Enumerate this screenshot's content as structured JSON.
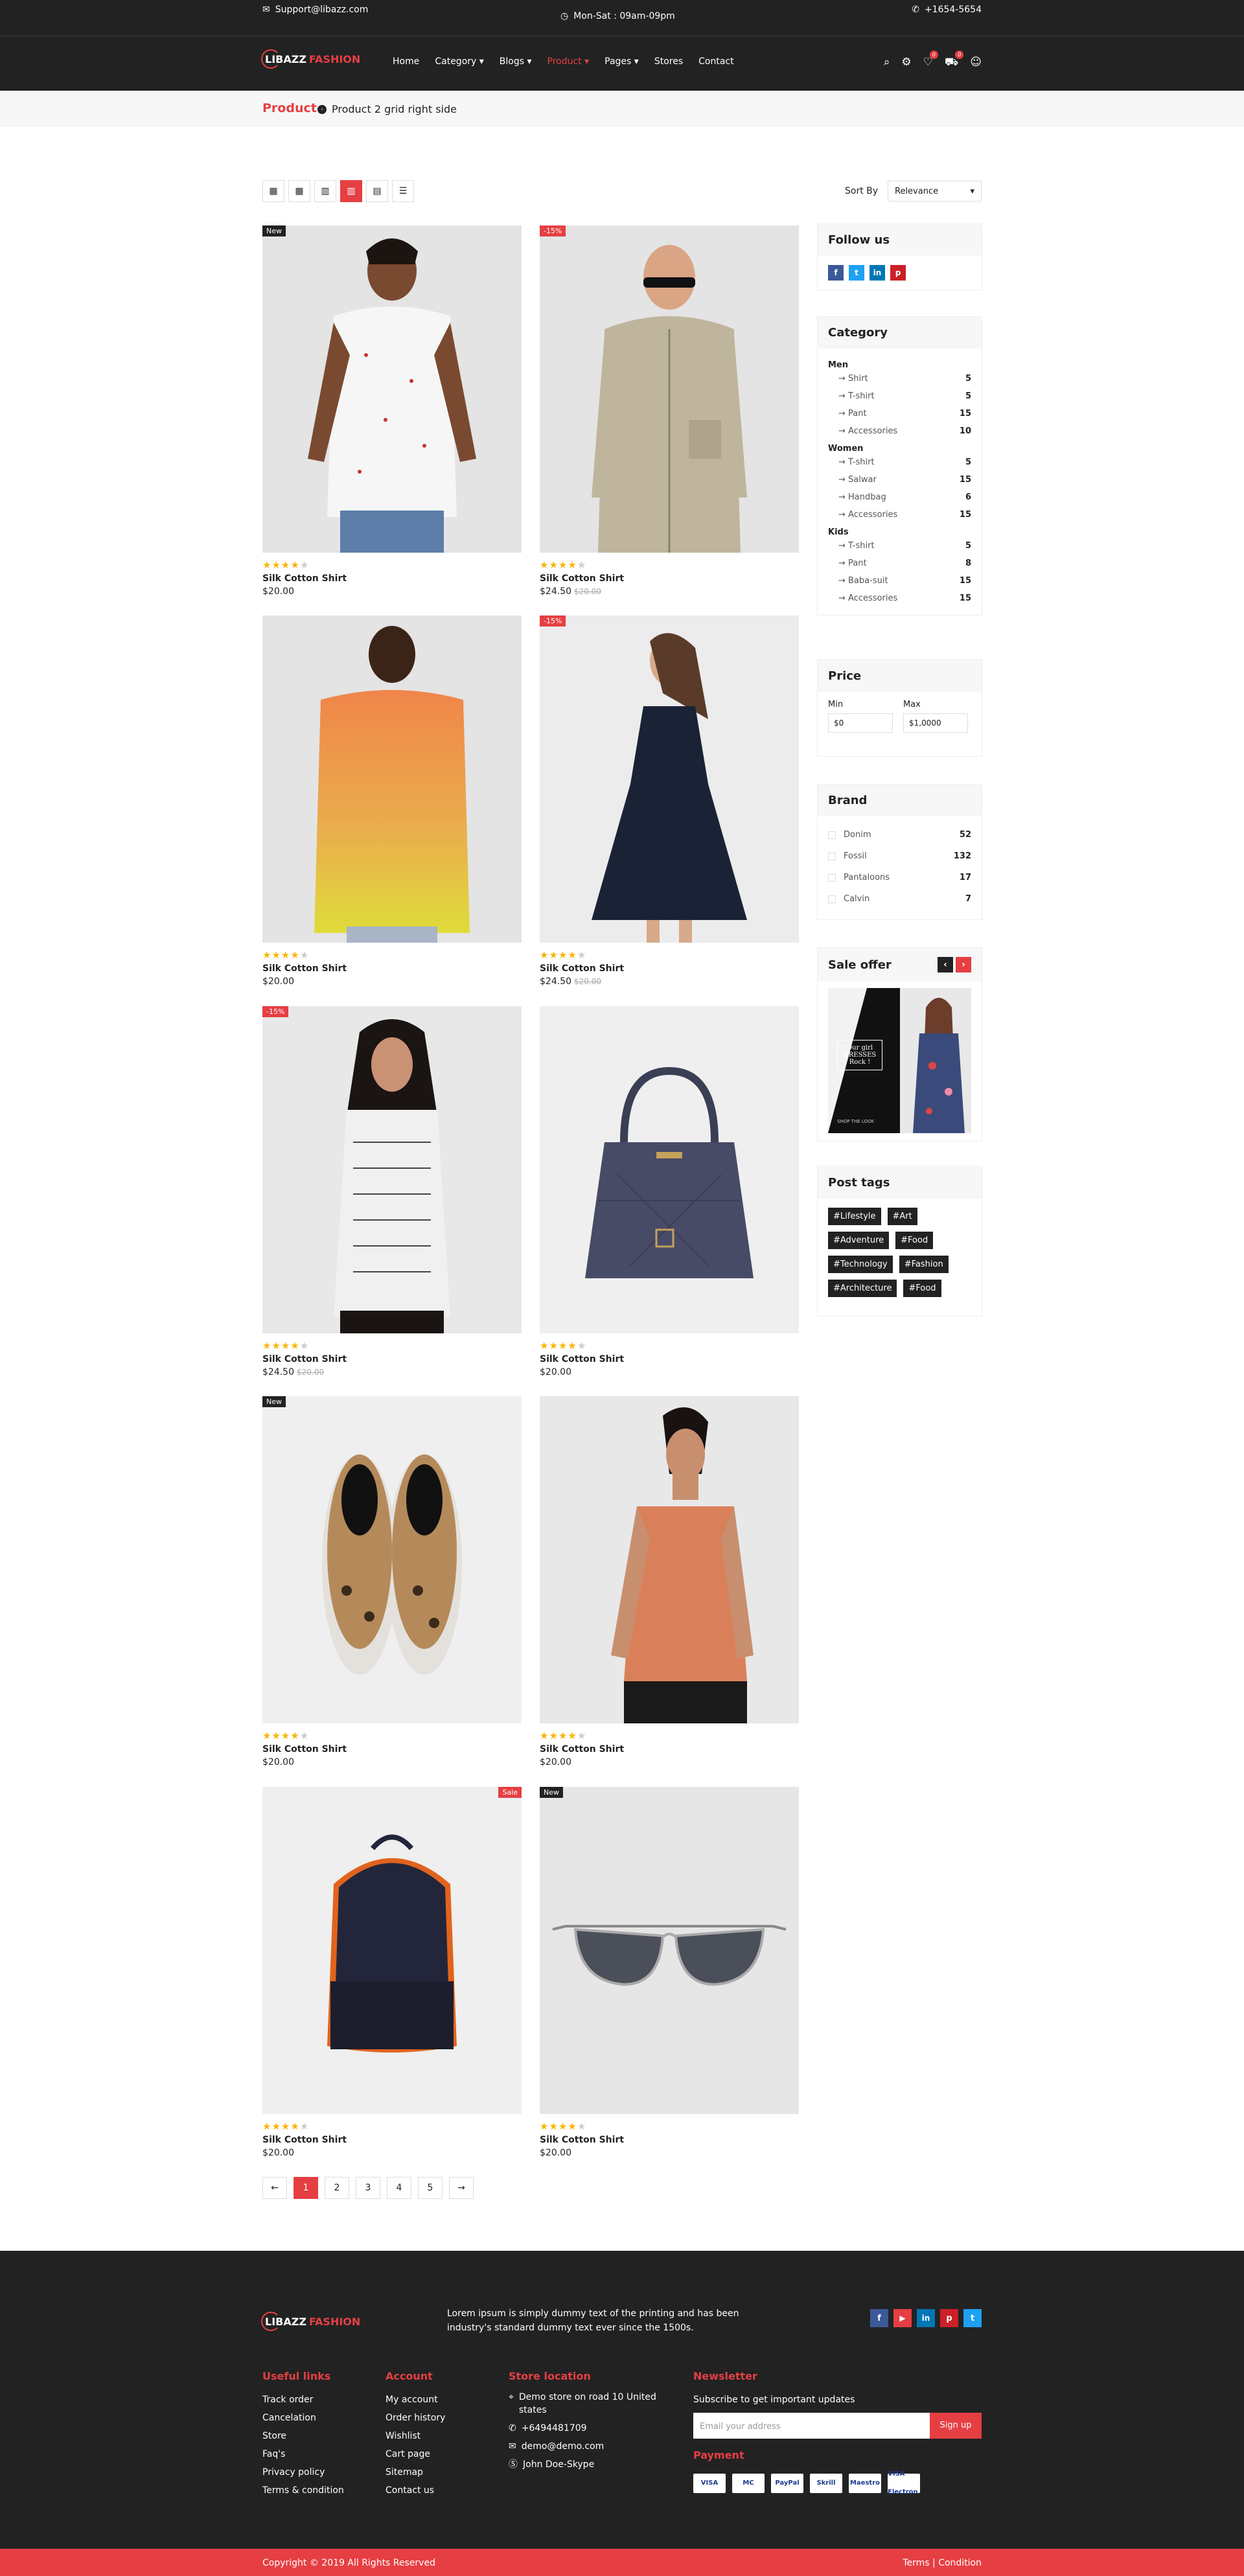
{
  "top": {
    "email": "Support@libazz.com",
    "hours": "Mon-Sat : 09am-09pm",
    "phone": "+1654-5654"
  },
  "brand": {
    "word1": "LIBAZZ",
    "word2": "FASHION"
  },
  "nav": [
    "Home",
    "Category",
    "Blogs",
    "Product",
    "Pages",
    "Stores",
    "Contact"
  ],
  "badges": {
    "wish": "0",
    "cart": "0"
  },
  "crumb": {
    "title": "Product",
    "sub": "Product 2 grid right side"
  },
  "sort": {
    "label": "Sort By",
    "value": "Relevance"
  },
  "products": [
    {
      "name": "Silk Cotton Shirt",
      "price": "$20.00",
      "old": "",
      "tag": "New",
      "tagType": "dark",
      "img": "shirt-man-white",
      "stars": 4
    },
    {
      "name": "Silk Cotton Shirt",
      "price": "$24.50",
      "old": "$20.00",
      "tag": "-15%",
      "tagType": "red",
      "img": "jacket-man",
      "stars": 4
    },
    {
      "name": "Silk Cotton Shirt",
      "price": "$20.00",
      "old": "",
      "tag": "",
      "tagType": "",
      "img": "shirt-orange",
      "stars": 4
    },
    {
      "name": "Silk Cotton Shirt",
      "price": "$24.50",
      "old": "$20.00",
      "tag": "-15%",
      "tagType": "red",
      "img": "dress-black",
      "stars": 4
    },
    {
      "name": "Silk Cotton Shirt",
      "price": "$24.50",
      "old": "$20.00",
      "tag": "-15%",
      "tagType": "red",
      "img": "top-print",
      "stars": 4
    },
    {
      "name": "Silk Cotton Shirt",
      "price": "$20.00",
      "old": "",
      "tag": "",
      "tagType": "",
      "img": "handbag",
      "stars": 4
    },
    {
      "name": "Silk Cotton Shirt",
      "price": "$20.00",
      "old": "",
      "tag": "New",
      "tagType": "dark",
      "img": "shoes",
      "stars": 4
    },
    {
      "name": "Silk Cotton Shirt",
      "price": "$20.00",
      "old": "",
      "tag": "",
      "tagType": "",
      "img": "camisole",
      "stars": 4
    },
    {
      "name": "Silk Cotton Shirt",
      "price": "$20.00",
      "old": "",
      "tag": "Sale",
      "tagType": "red",
      "img": "backpack",
      "stars": 4
    },
    {
      "name": "Silk Cotton Shirt",
      "price": "$20.00",
      "old": "",
      "tag": "New",
      "tagType": "dark",
      "img": "sunglasses",
      "stars": 4
    }
  ],
  "follow": {
    "title": "Follow us",
    "icons": [
      "f",
      "t",
      "in",
      "p"
    ]
  },
  "category": {
    "title": "Category",
    "groups": [
      {
        "name": "Men",
        "items": [
          [
            "Shirt",
            "5"
          ],
          [
            "T-shirt",
            "5"
          ],
          [
            "Pant",
            "15"
          ],
          [
            "Accessories",
            "10"
          ]
        ]
      },
      {
        "name": "Women",
        "items": [
          [
            "T-shirt",
            "5"
          ],
          [
            "Salwar",
            "15"
          ],
          [
            "Handbag",
            "6"
          ],
          [
            "Accessories",
            "15"
          ]
        ]
      },
      {
        "name": "Kids",
        "items": [
          [
            "T-shirt",
            "5"
          ],
          [
            "Pant",
            "8"
          ],
          [
            "Baba-suit",
            "15"
          ],
          [
            "Accessories",
            "15"
          ]
        ]
      }
    ]
  },
  "price": {
    "title": "Price",
    "min_label": "Min",
    "max_label": "Max",
    "min": "$0",
    "max": "$1,0000"
  },
  "brands": {
    "title": "Brand",
    "items": [
      [
        "Donim",
        "52"
      ],
      [
        "Fossil",
        "132"
      ],
      [
        "Pantaloons",
        "17"
      ],
      [
        "Calvin",
        "7"
      ]
    ]
  },
  "sale": {
    "title": "Sale offer",
    "text": "Our girl DRESSES Rock !",
    "foot": "SHOP THE LOOK"
  },
  "tags": {
    "title": "Post tags",
    "items": [
      "#Lifestyle",
      "#Art",
      "#Adventure",
      "#Food",
      "#Technology",
      "#Fashion",
      "#Architecture",
      "#Food"
    ]
  },
  "pages": [
    "←",
    "1",
    "2",
    "3",
    "4",
    "5",
    "→"
  ],
  "footer": {
    "about": "Lorem ipsum is simply dummy text of the printing and has been industry's standard dummy text ever since the 1500s.",
    "social": [
      "f",
      "▶",
      "in",
      "p",
      "t"
    ],
    "useful": {
      "title": "Useful links",
      "items": [
        "Track order",
        "Cancelation",
        "Store",
        "Faq's",
        "Privacy policy",
        "Terms & condition"
      ]
    },
    "account": {
      "title": "Account",
      "items": [
        "My account",
        "Order history",
        "Wishlist",
        "Cart page",
        "Sitemap",
        "Contact us"
      ]
    },
    "store": {
      "title": "Store location",
      "addr": "Demo store on road 10 United states",
      "phone": "+6494481709",
      "email": "demo@demo.com",
      "skype": "John Doe-Skype"
    },
    "news": {
      "title": "Newsletter",
      "sub": "Subscribe to get important updates",
      "placeholder": "Email your address",
      "btn": "Sign up",
      "pay_title": "Payment",
      "pay": [
        "VISA",
        "MC",
        "PayPal",
        "Skrill",
        "Maestro",
        "VISA Electron"
      ]
    }
  },
  "copy": {
    "left": "Copyright © 2019 All Rights Reserved",
    "right": "Terms | Condition"
  },
  "colors": {
    "accent": "#e53f43",
    "dark": "#222222"
  }
}
